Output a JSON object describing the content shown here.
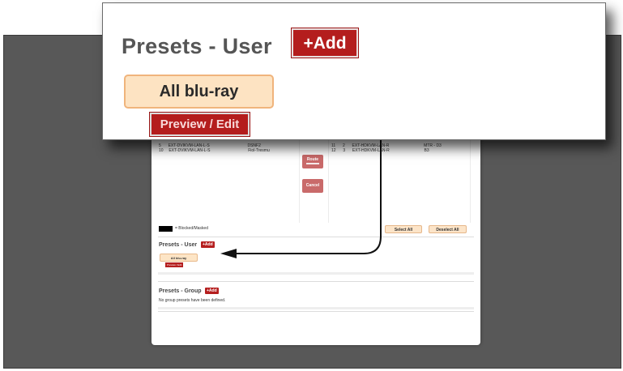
{
  "callout": {
    "title": "Presets - User",
    "add_label": "+Add",
    "preset_label": "All blu-ray",
    "preview_label": "Preview / Edit"
  },
  "routes": {
    "left_rows": [
      {
        "num": "5",
        "device": "EXT-DVIKVM-LAN-L-S",
        "name": "DSNF2"
      },
      {
        "num": "10",
        "device": "EXT-DVIKVM-LAN-L-S",
        "name": "Fiol-Tresmu"
      }
    ],
    "right_rows": [
      {
        "num": "11",
        "port": "2",
        "device": "EXT-HDKVM-LAN-R",
        "name": "MTR - D3"
      },
      {
        "num": "12",
        "port": "3",
        "device": "EXT-HDKVM-LAN-R",
        "name": "B3"
      }
    ],
    "route_label": "Route",
    "cancel_label": "Cancel"
  },
  "legend": {
    "text": "= Blocked/Masked"
  },
  "selection": {
    "select_all": "Select All",
    "deselect_all": "Deselect All"
  },
  "presets_user": {
    "title": "Presets - User",
    "add_label": "+Add",
    "preset_label": "All blu-ray",
    "preview_label": "Preview / Edit"
  },
  "presets_group": {
    "title": "Presets - Group",
    "add_label": "+Add",
    "empty_text": "No group presets have been defined."
  },
  "colors": {
    "background_frame": "#585858",
    "accent_red": "#b41d1d",
    "preset_fill": "#fde3c2",
    "preset_border": "#f0b47c"
  }
}
